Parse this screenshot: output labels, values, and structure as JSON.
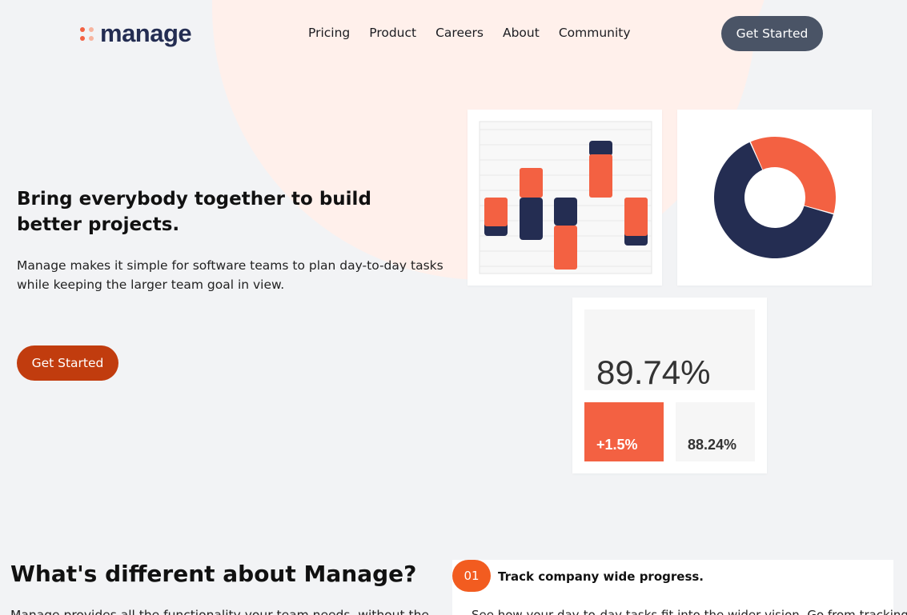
{
  "brand": {
    "name": "manage",
    "dot_colors": [
      "#f36142",
      "#f7b49f",
      "#f36142",
      "#f7b49f"
    ]
  },
  "nav": {
    "items": [
      "Pricing",
      "Product",
      "Careers",
      "About",
      "Community"
    ],
    "cta": "Get Started"
  },
  "hero": {
    "title": "Bring everybody together to build better projects.",
    "text": "Manage makes it simple for software teams to plan day-to-day tasks while keeping the larger team goal in view.",
    "cta": "Get Started"
  },
  "stats": {
    "main": "89.74%",
    "change": "+1.5%",
    "secondary": "88.24%"
  },
  "colors": {
    "navy": "#242d52",
    "orange": "#f36142",
    "button_gray": "#4a5466",
    "button_red": "#c13c0e"
  },
  "chart_data": [
    {
      "type": "bar",
      "series": [
        {
          "name": "",
          "values": [
            [
              0,
              -48
            ],
            [
              -20,
              90
            ],
            [
              0,
              -53
            ],
            [
              -70,
              0
            ],
            [
              0,
              -58
            ]
          ]
        }
      ],
      "dark_values": [
        [
          0,
          -48
        ],
        [
          -20,
          -90
        ],
        [
          0,
          -35
        ],
        [
          -70,
          -12
        ],
        [
          0,
          -58
        ]
      ]
    },
    {
      "type": "pie",
      "values": [
        36,
        64
      ],
      "colors": [
        "#f36142",
        "#242d52"
      ]
    }
  ],
  "section": {
    "title": "What's different about Manage?",
    "text": "Manage provides all the functionality your team needs, without the"
  },
  "feature": {
    "num": "01",
    "title": "Track company wide progress.",
    "text": "See how your day-to-day tasks fit into the wider vision. Go from tracking"
  }
}
